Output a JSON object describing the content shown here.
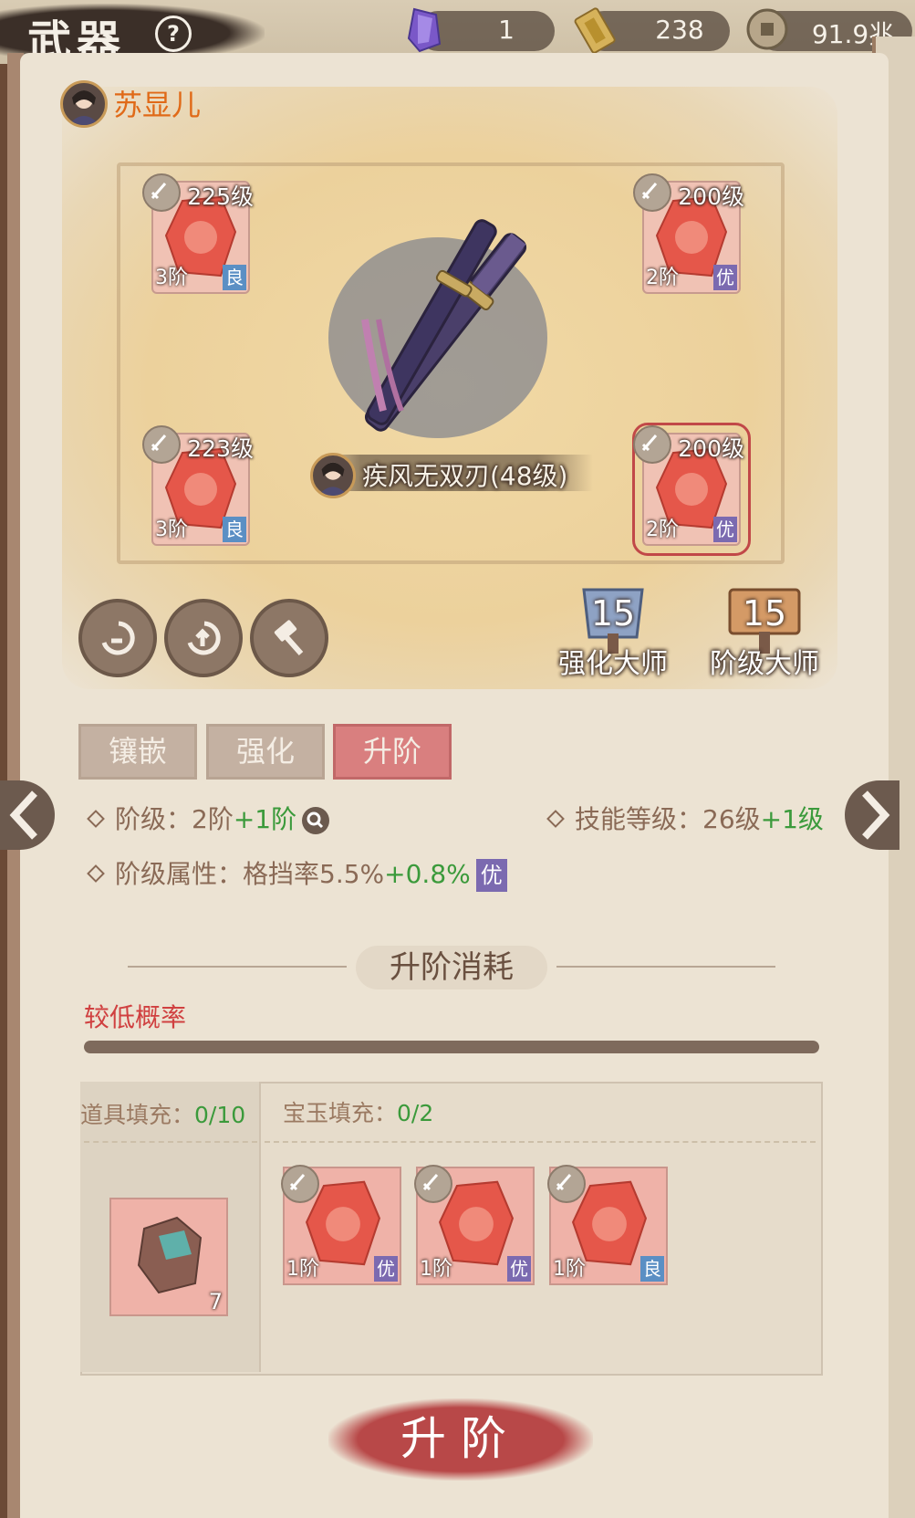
{
  "header": {
    "title": "武器",
    "help_icon": "?",
    "resources": [
      {
        "icon": "purple-crystal-icon",
        "value": "1"
      },
      {
        "icon": "gold-token-icon",
        "value": "238"
      },
      {
        "icon": "copper-coin-icon",
        "value": "91.9兆"
      }
    ]
  },
  "character": {
    "name": "苏显儿"
  },
  "weapon": {
    "name": "疾风无双刃(48级)"
  },
  "slots": [
    {
      "level": "225级",
      "tier": "3阶",
      "quality": "良"
    },
    {
      "level": "200级",
      "tier": "2阶",
      "quality": "优"
    },
    {
      "level": "223级",
      "tier": "3阶",
      "quality": "良"
    },
    {
      "level": "200级",
      "tier": "2阶",
      "quality": "优"
    }
  ],
  "masters": [
    {
      "value": "15",
      "label": "强化大师"
    },
    {
      "value": "15",
      "label": "阶级大师"
    }
  ],
  "tabs": [
    "镶嵌",
    "强化",
    "升阶"
  ],
  "active_tab": "升阶",
  "attributes": {
    "tier_label": "阶级：",
    "tier_value": "2阶",
    "tier_bonus": "+1阶",
    "skill_label": "技能等级：",
    "skill_value": "26级",
    "skill_bonus": "+1级",
    "attr_label": "阶级属性：",
    "attr_value": "格挡率5.5%",
    "attr_bonus": "+0.8%",
    "attr_quality": "优"
  },
  "cost": {
    "title": "升阶消耗",
    "probability": "较低概率",
    "item_fill_label": "道具填充：",
    "item_fill_value": "0/10",
    "jade_fill_label": "宝玉填充：",
    "jade_fill_value": "0/2",
    "item_count": "7",
    "jades": [
      {
        "tier": "1阶",
        "quality": "优"
      },
      {
        "tier": "1阶",
        "quality": "优"
      },
      {
        "tier": "1阶",
        "quality": "良"
      }
    ]
  },
  "action": {
    "upgrade_label": "升阶"
  },
  "colors": {
    "accent_red": "#d97f7f",
    "bonus_green": "#3b9a3b",
    "quality_good": "#5b8fc4",
    "quality_great": "#7b6ab0"
  }
}
